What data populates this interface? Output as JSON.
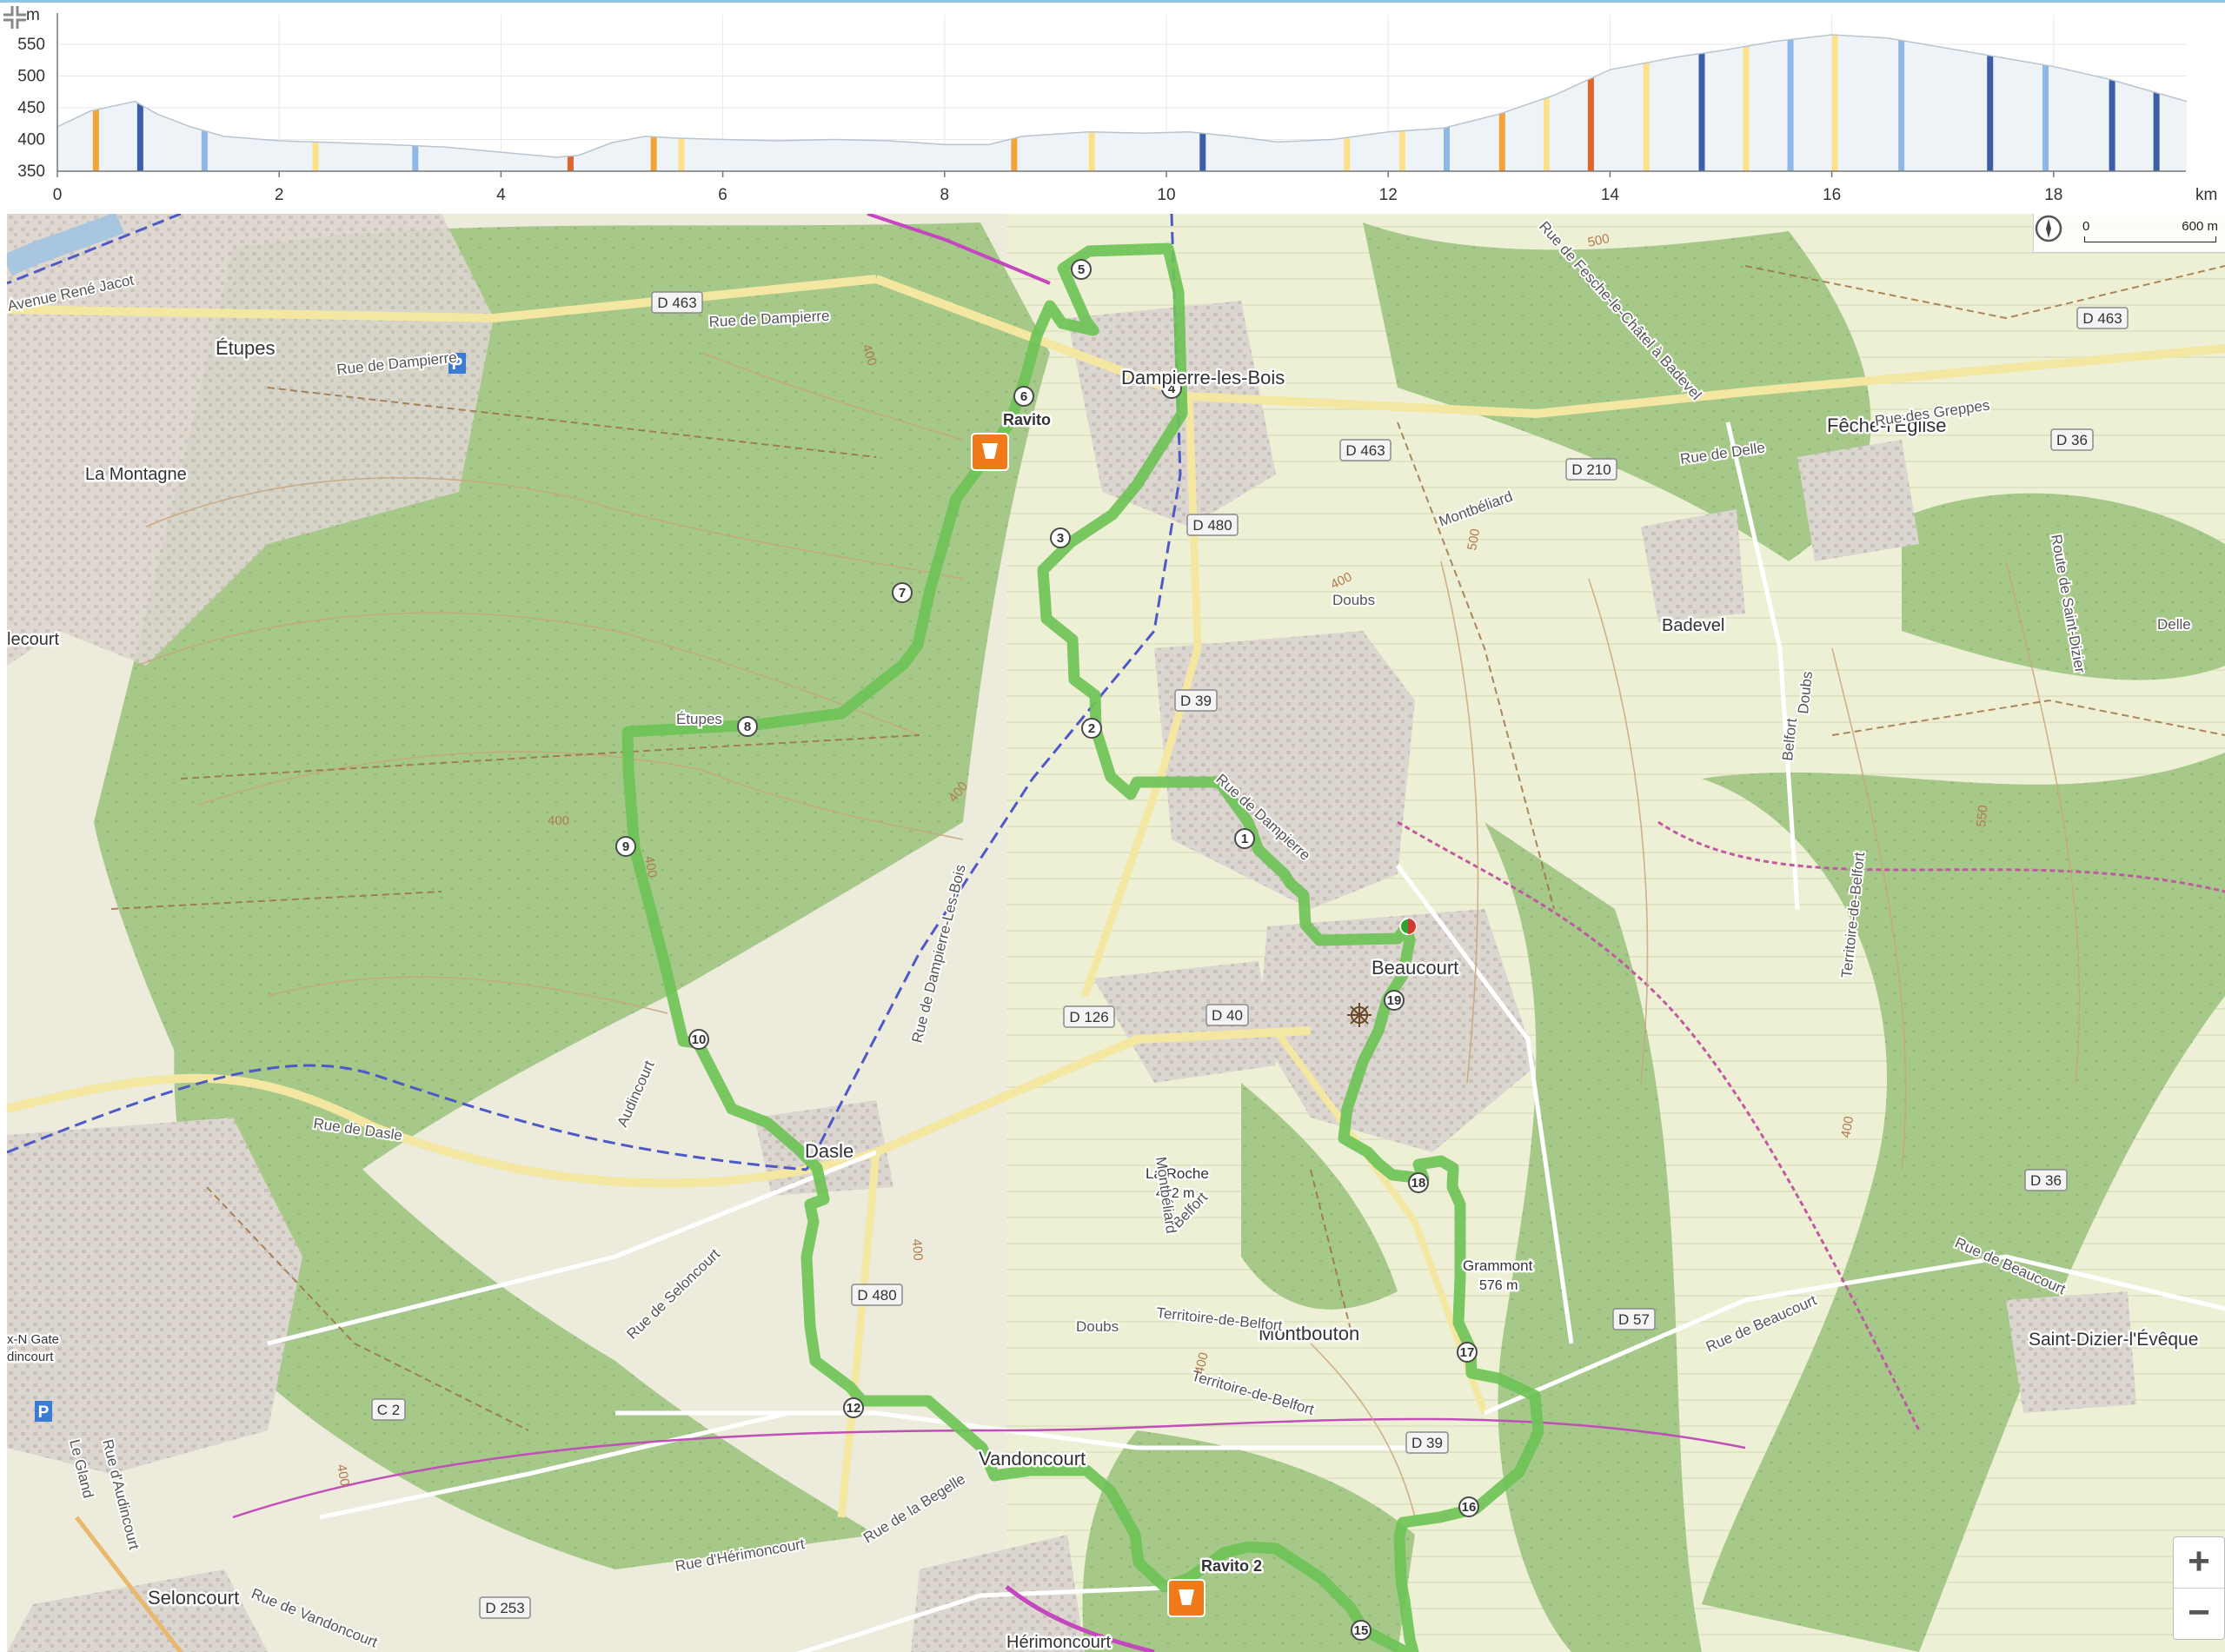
{
  "profile": {
    "y_unit": "m",
    "x_unit": "km",
    "y_ticks": [
      "550",
      "500",
      "450",
      "400",
      "350"
    ],
    "x_ticks": [
      "0",
      "2",
      "4",
      "6",
      "8",
      "10",
      "12",
      "14",
      "16",
      "18"
    ],
    "elevation": [
      [
        0,
        420
      ],
      [
        0.3,
        445
      ],
      [
        0.7,
        460
      ],
      [
        0.9,
        440
      ],
      [
        1.2,
        420
      ],
      [
        1.5,
        405
      ],
      [
        2,
        398
      ],
      [
        2.5,
        395
      ],
      [
        3,
        392
      ],
      [
        3.5,
        388
      ],
      [
        4,
        380
      ],
      [
        4.5,
        372
      ],
      [
        4.7,
        375
      ],
      [
        5,
        395
      ],
      [
        5.3,
        405
      ],
      [
        5.6,
        402
      ],
      [
        6,
        400
      ],
      [
        6.5,
        398
      ],
      [
        7,
        400
      ],
      [
        7.5,
        398
      ],
      [
        8,
        392
      ],
      [
        8.4,
        392
      ],
      [
        8.7,
        405
      ],
      [
        9.3,
        412
      ],
      [
        9.8,
        410
      ],
      [
        10.2,
        412
      ],
      [
        10.6,
        405
      ],
      [
        11,
        396
      ],
      [
        11.5,
        400
      ],
      [
        12,
        412
      ],
      [
        12.5,
        418
      ],
      [
        13,
        440
      ],
      [
        13.5,
        470
      ],
      [
        14,
        510
      ],
      [
        14.6,
        530
      ],
      [
        15,
        540
      ],
      [
        15.5,
        555
      ],
      [
        16,
        565
      ],
      [
        16.5,
        560
      ],
      [
        17,
        545
      ],
      [
        17.5,
        530
      ],
      [
        18,
        515
      ],
      [
        18.5,
        495
      ],
      [
        19,
        470
      ],
      [
        19.2,
        460
      ]
    ],
    "stripes": [
      {
        "km": 0.32,
        "color": "#f2a33a"
      },
      {
        "km": 0.72,
        "color": "#3a5fa8"
      },
      {
        "km": 1.3,
        "color": "#8fb8e6"
      },
      {
        "km": 2.3,
        "color": "#fde08a"
      },
      {
        "km": 3.2,
        "color": "#8fb8e6"
      },
      {
        "km": 4.6,
        "color": "#e0642c"
      },
      {
        "km": 5.35,
        "color": "#f2a33a"
      },
      {
        "km": 5.6,
        "color": "#fde08a"
      },
      {
        "km": 8.6,
        "color": "#f2a33a"
      },
      {
        "km": 9.3,
        "color": "#fde08a"
      },
      {
        "km": 10.3,
        "color": "#3a5fa8"
      },
      {
        "km": 11.6,
        "color": "#fde08a"
      },
      {
        "km": 12.1,
        "color": "#fde08a"
      },
      {
        "km": 12.5,
        "color": "#8fb8e6"
      },
      {
        "km": 13.0,
        "color": "#f2a33a"
      },
      {
        "km": 13.4,
        "color": "#fde08a"
      },
      {
        "km": 13.8,
        "color": "#e0642c"
      },
      {
        "km": 14.3,
        "color": "#fde08a"
      },
      {
        "km": 14.8,
        "color": "#3a5fa8"
      },
      {
        "km": 15.2,
        "color": "#fde08a"
      },
      {
        "km": 15.6,
        "color": "#8fb8e6"
      },
      {
        "km": 16.0,
        "color": "#fde08a"
      },
      {
        "km": 16.6,
        "color": "#8fb8e6"
      },
      {
        "km": 17.4,
        "color": "#3a5fa8"
      },
      {
        "km": 17.9,
        "color": "#8fb8e6"
      },
      {
        "km": 18.5,
        "color": "#3a5fa8"
      },
      {
        "km": 18.9,
        "color": "#3a5fa8"
      }
    ]
  },
  "map": {
    "scale": {
      "zero": "0",
      "distance": "600 m"
    },
    "icons": {
      "compass": "compass-icon",
      "collapse": "collapse-icon",
      "zoom_in": "+",
      "zoom_out": "−",
      "parking": "P"
    },
    "route_color": "#6ec356",
    "pois": [
      {
        "name": "Ravito",
        "icon": "food-station-icon"
      },
      {
        "name": "Ravito 2",
        "icon": "food-station-icon"
      }
    ],
    "km_markers": [
      "1",
      "2",
      "3",
      "4",
      "5",
      "6",
      "7",
      "8",
      "9",
      "10",
      "12",
      "15",
      "16",
      "17",
      "18",
      "19"
    ],
    "places": [
      "Étupes",
      "Dampierre-les-Bois",
      "La Montagne",
      "Fêche-l'Église",
      "Badevel",
      "Beaucourt",
      "Dasle",
      "La Roche",
      "462 m",
      "Grammont",
      "576 m",
      "Montbouton",
      "Vandoncourt",
      "Saint-Dizier-l'Évêque",
      "Seloncourt",
      "Hérimoncourt"
    ],
    "roads": [
      "Avenue René Jacot",
      "Rue de Dampierre",
      "Rue de Dampierre",
      "Rue de Fesche-le-Châtel à Badevel",
      "Rue des Greppes",
      "Rue de Delle",
      "Route de Saint-Dizier",
      "Rue de Dampierre",
      "Rue de Dampierre-Les-Bois",
      "Rue de Dasle",
      "Rue de Seloncourt",
      "Rue de la Begelle",
      "Rue d'Hérimoncourt",
      "Rue de Vandoncourt",
      "Rue de Beaucourt",
      "Rue de Beaucourt",
      "Rue d'Audincourt",
      "Étupes",
      "Montbéliard",
      "Doubs",
      "Belfort",
      "Territoire-de-Belfort",
      "Doubs",
      "Territoire-de-Belfort",
      "Belfort",
      "Delle",
      "Montbéliard",
      "Doubs",
      "Territoire-de-Belfort",
      "Le Gland",
      "Audincourt"
    ],
    "shields": [
      "D 463",
      "D 463",
      "D 463",
      "D 210",
      "D 36",
      "D 480",
      "D 39",
      "D 126",
      "D 40",
      "D 36",
      "D 480",
      "D 57",
      "C 2",
      "D 39",
      "D 253"
    ],
    "edge_labels": [
      "lecourt",
      "x-N Gate",
      "dincourt"
    ],
    "contours": [
      "400",
      "400",
      "400",
      "400",
      "400",
      "400",
      "400",
      "550",
      "400",
      "500",
      "500",
      "400"
    ]
  }
}
